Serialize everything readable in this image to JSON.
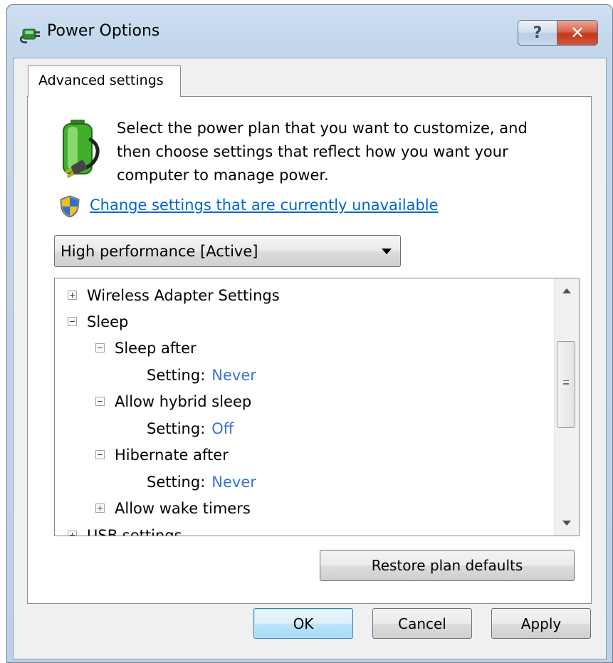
{
  "window": {
    "title": "Power Options",
    "help_label": "?",
    "close_label": "✕"
  },
  "tabs": [
    {
      "label": "Advanced settings",
      "selected": true
    }
  ],
  "intro": {
    "line1": "Select the power plan that you want to customize, and",
    "line2": "then choose settings that reflect how you want your",
    "line3": "computer to manage power."
  },
  "link": {
    "label": "Change settings that are currently unavailable"
  },
  "plan": {
    "selected": "High performance [Active]"
  },
  "tree": {
    "rows": [
      {
        "label": "Wireless Adapter Settings",
        "toggle": "plus"
      },
      {
        "label": "Sleep",
        "toggle": "minus"
      },
      {
        "label": "Sleep after",
        "toggle": "minus"
      },
      {
        "setting_label": "Setting:",
        "value": "Never"
      },
      {
        "label": "Allow hybrid sleep",
        "toggle": "minus"
      },
      {
        "setting_label": "Setting:",
        "value": "Off"
      },
      {
        "label": "Hibernate after",
        "toggle": "minus"
      },
      {
        "setting_label": "Setting:",
        "value": "Never"
      },
      {
        "label": "Allow wake timers",
        "toggle": "plus"
      },
      {
        "label": "USB settings",
        "toggle": "plus"
      }
    ]
  },
  "buttons": {
    "restore": "Restore plan defaults",
    "ok": "OK",
    "cancel": "Cancel",
    "apply": "Apply"
  },
  "colors": {
    "link": "#0066cc",
    "setting_value": "#3b74d1",
    "close_button": "#c2391b"
  },
  "icons": {
    "app": "power-plug-icon",
    "battery": "battery-plug-icon",
    "shield": "uac-shield-icon"
  }
}
